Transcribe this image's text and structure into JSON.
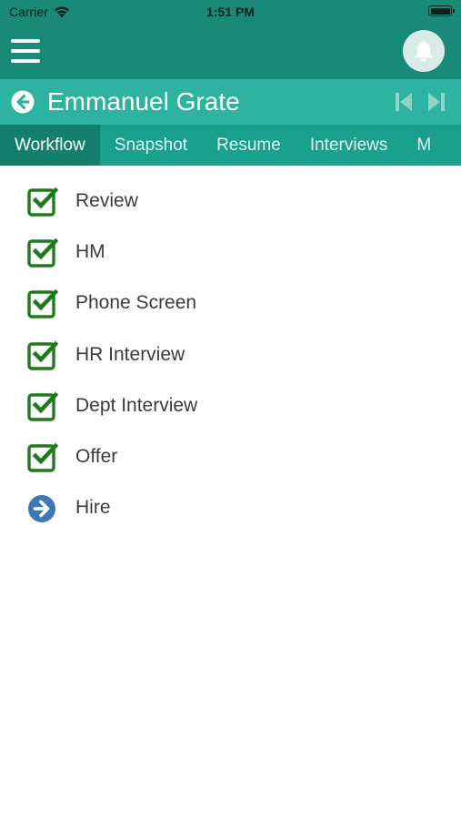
{
  "status_bar": {
    "carrier": "Carrier",
    "time": "1:51 PM"
  },
  "header": {
    "menu_icon": "hamburger-menu-icon",
    "notification_icon": "bell-icon"
  },
  "candidate": {
    "name": "Emmanuel Grate",
    "back_icon": "arrow-left-circle-icon",
    "prev_icon": "skip-first-icon",
    "next_icon": "skip-last-icon"
  },
  "tabs": [
    {
      "label": "Workflow",
      "active": true
    },
    {
      "label": "Snapshot",
      "active": false
    },
    {
      "label": "Resume",
      "active": false
    },
    {
      "label": "Interviews",
      "active": false
    },
    {
      "label": "M",
      "active": false
    }
  ],
  "workflow": {
    "steps": [
      {
        "label": "Review",
        "status": "completed"
      },
      {
        "label": "HM",
        "status": "completed"
      },
      {
        "label": "Phone Screen",
        "status": "completed"
      },
      {
        "label": "HR Interview",
        "status": "completed"
      },
      {
        "label": "Dept Interview",
        "status": "completed"
      },
      {
        "label": "Offer",
        "status": "completed"
      },
      {
        "label": "Hire",
        "status": "current"
      }
    ]
  },
  "colors": {
    "header_dark": "#1a8a78",
    "header_light": "#2db3a0",
    "tab_bar": "#1aa18d",
    "tab_active": "#13806f",
    "check_green": "#1f7a1f",
    "current_blue": "#3d79b3"
  }
}
